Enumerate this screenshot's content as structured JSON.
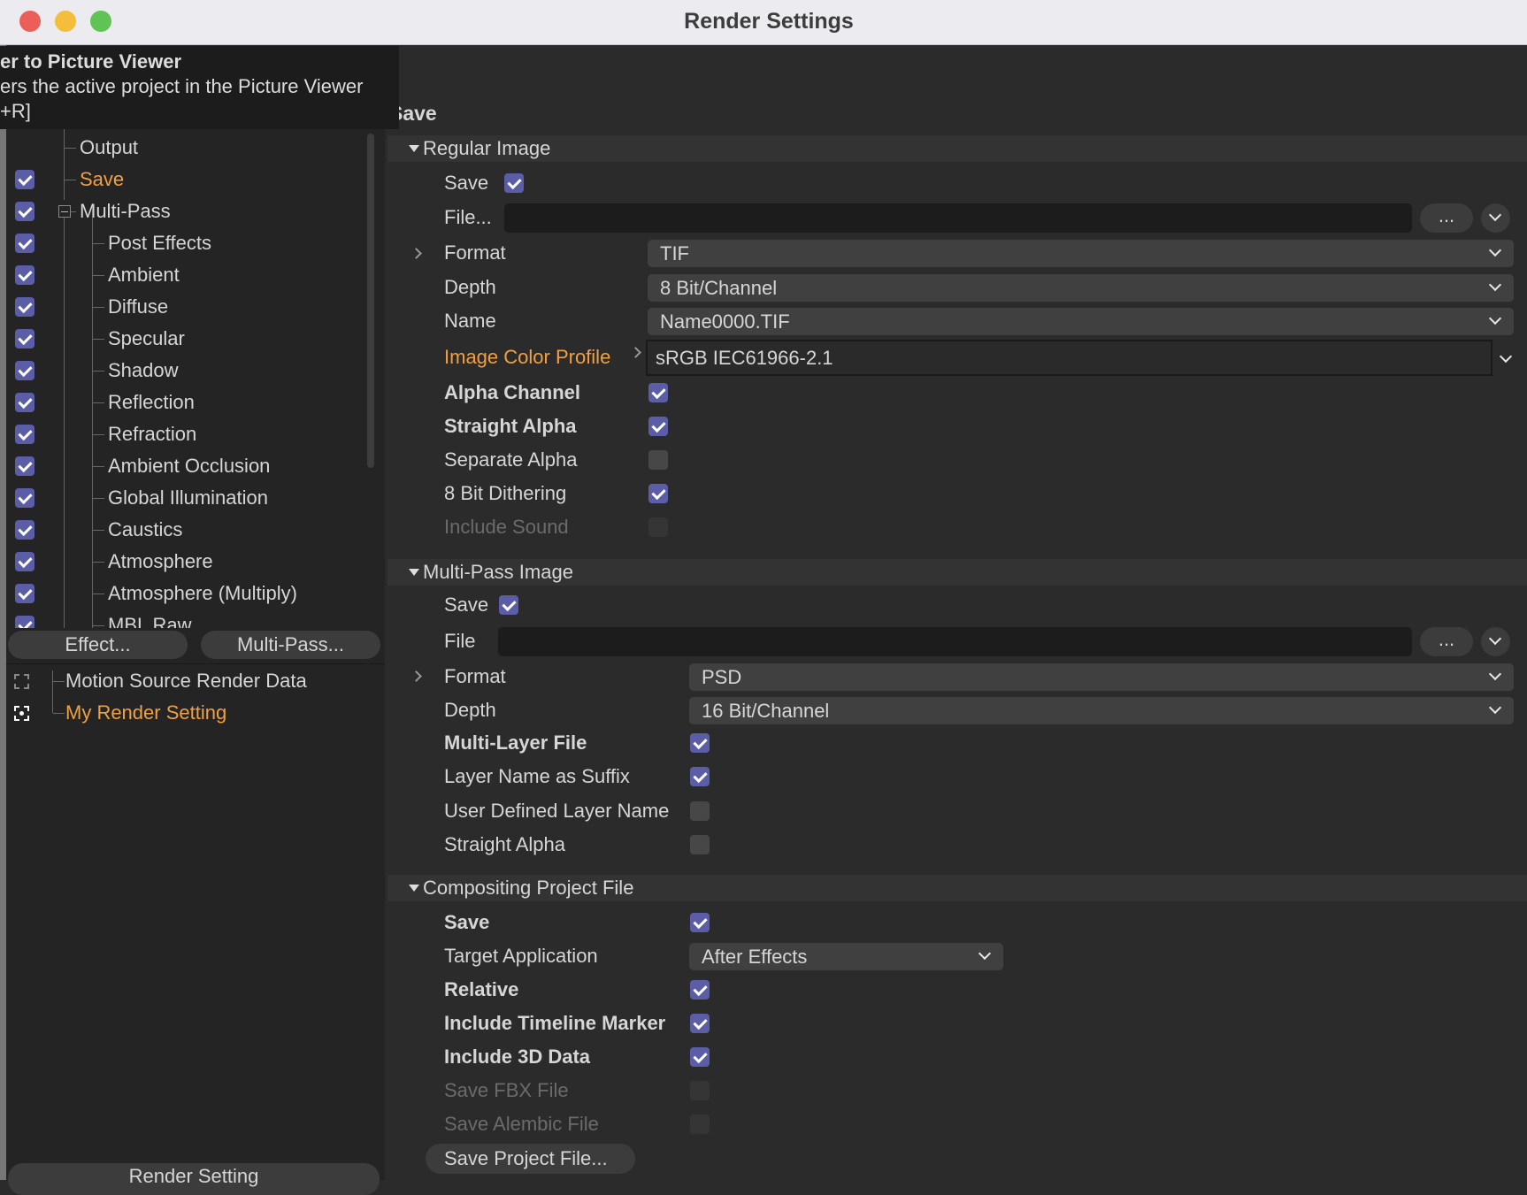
{
  "window": {
    "title": "Render Settings"
  },
  "tooltip": {
    "title": "er to Picture Viewer",
    "description": "ers the active project in the Picture Viewer",
    "shortcut": "+R]"
  },
  "tree": {
    "items": [
      {
        "label": "Output",
        "level": 1,
        "checkbox": null,
        "active": false
      },
      {
        "label": "Save",
        "level": 1,
        "checkbox": true,
        "active": true
      },
      {
        "label": "Multi-Pass",
        "level": 1,
        "checkbox": true,
        "active": false,
        "collapsible": true
      },
      {
        "label": "Post Effects",
        "level": 2,
        "checkbox": true
      },
      {
        "label": "Ambient",
        "level": 2,
        "checkbox": true
      },
      {
        "label": "Diffuse",
        "level": 2,
        "checkbox": true
      },
      {
        "label": "Specular",
        "level": 2,
        "checkbox": true
      },
      {
        "label": "Shadow",
        "level": 2,
        "checkbox": true
      },
      {
        "label": "Reflection",
        "level": 2,
        "checkbox": true
      },
      {
        "label": "Refraction",
        "level": 2,
        "checkbox": true
      },
      {
        "label": "Ambient Occlusion",
        "level": 2,
        "checkbox": true
      },
      {
        "label": "Global Illumination",
        "level": 2,
        "checkbox": true
      },
      {
        "label": "Caustics",
        "level": 2,
        "checkbox": true
      },
      {
        "label": "Atmosphere",
        "level": 2,
        "checkbox": true
      },
      {
        "label": "Atmosphere (Multiply)",
        "level": 2,
        "checkbox": true
      },
      {
        "label": "MBL Raw",
        "level": 2,
        "checkbox": true
      }
    ],
    "effect_button": "Effect...",
    "multipass_button": "Multi-Pass..."
  },
  "settings_list": [
    {
      "label": "Motion Source Render Data",
      "active": false
    },
    {
      "label": "My Render Setting",
      "active": true
    }
  ],
  "render_setting_button": "Render Setting",
  "main": {
    "heading": "Save",
    "regular": {
      "title": "Regular Image",
      "save_label": "Save",
      "save": true,
      "file_label": "File...",
      "file_value": "",
      "browse": "...",
      "format_label": "Format",
      "format": "TIF",
      "depth_label": "Depth",
      "depth": "8 Bit/Channel",
      "name_label": "Name",
      "name": "Name0000.TIF",
      "profile_label": "Image Color Profile",
      "profile": "sRGB IEC61966-2.1",
      "options": [
        {
          "label": "Alpha Channel",
          "checked": true,
          "bold": true,
          "disabled": false
        },
        {
          "label": "Straight Alpha",
          "checked": true,
          "bold": true,
          "disabled": false
        },
        {
          "label": "Separate Alpha",
          "checked": false,
          "bold": false,
          "disabled": false
        },
        {
          "label": "8 Bit Dithering",
          "checked": true,
          "bold": false,
          "disabled": false
        },
        {
          "label": "Include Sound",
          "checked": false,
          "bold": false,
          "disabled": true
        }
      ]
    },
    "multipass": {
      "title": "Multi-Pass Image",
      "save_label": "Save",
      "save": true,
      "file_label": "File",
      "file_value": "",
      "browse": "...",
      "format_label": "Format",
      "format": "PSD",
      "depth_label": "Depth",
      "depth": "16 Bit/Channel",
      "options": [
        {
          "label": "Multi-Layer File",
          "checked": true,
          "bold": true,
          "disabled": false
        },
        {
          "label": "Layer Name as Suffix",
          "checked": true,
          "bold": false,
          "disabled": false
        },
        {
          "label": "User Defined Layer Name",
          "checked": false,
          "bold": false,
          "disabled": false
        },
        {
          "label": "Straight Alpha",
          "checked": false,
          "bold": false,
          "disabled": false
        }
      ]
    },
    "compositing": {
      "title": "Compositing Project File",
      "save_label": "Save",
      "save": true,
      "target_label": "Target Application",
      "target": "After Effects",
      "options": [
        {
          "label": "Relative",
          "checked": true,
          "bold": true,
          "disabled": false
        },
        {
          "label": "Include Timeline Marker",
          "checked": true,
          "bold": true,
          "disabled": false
        },
        {
          "label": "Include 3D Data",
          "checked": true,
          "bold": true,
          "disabled": false
        },
        {
          "label": "Save FBX File",
          "checked": false,
          "bold": false,
          "disabled": true
        },
        {
          "label": "Save Alembic File",
          "checked": false,
          "bold": false,
          "disabled": true
        }
      ],
      "save_project_button": "Save Project File..."
    }
  },
  "colors": {
    "accent": "#5b5ea6",
    "active_text": "#f0a042",
    "close": "#ec5f58",
    "minimize": "#f4bd3b",
    "zoom": "#5fc453"
  }
}
